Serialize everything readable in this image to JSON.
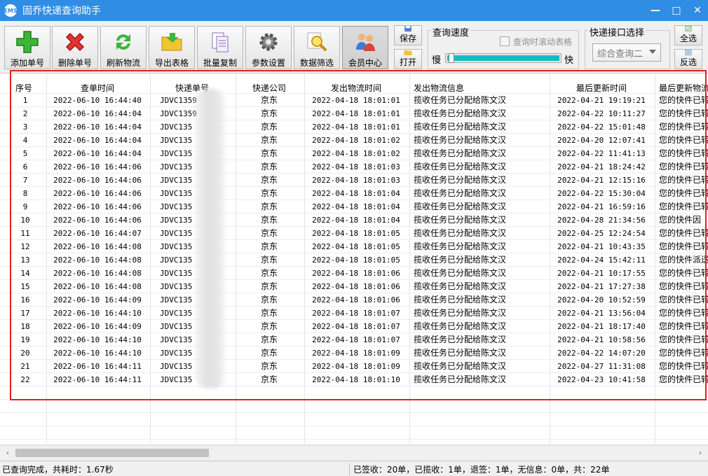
{
  "window": {
    "title": "固乔快递查询助手",
    "icon_text": "EMS",
    "minimize": "—",
    "maximize": "□",
    "close": "✕"
  },
  "toolbar": {
    "buttons": [
      {
        "label": "添加单号",
        "icon": "plus-icon"
      },
      {
        "label": "删除单号",
        "icon": "delete-x-icon"
      },
      {
        "label": "刷新物流",
        "icon": "refresh-icon"
      },
      {
        "label": "导出表格",
        "icon": "folder-export-icon"
      },
      {
        "label": "批量复制",
        "icon": "copy-pages-icon"
      },
      {
        "label": "参数设置",
        "icon": "gear-icon"
      },
      {
        "label": "数据筛选",
        "icon": "magnifier-icon"
      },
      {
        "label": "会员中心",
        "icon": "users-icon"
      }
    ],
    "save_label": "保存",
    "open_label": "打开",
    "speed": {
      "title": "查询速度",
      "scroll_checkbox_label": "查询时滚动表格",
      "slow_label": "慢",
      "fast_label": "快",
      "level": 1.0
    },
    "interface": {
      "title": "快递接口选择",
      "selected": "综合查询二"
    },
    "select_all_label": "全选",
    "invert_label": "反选"
  },
  "table": {
    "columns": [
      "序号",
      "查单时间",
      "快递单号",
      "快递公司",
      "发出物流时间",
      "发出物流信息",
      "最后更新时间",
      "最后更新物流"
    ],
    "rows": [
      [
        "1",
        "2022-06-10 16:44:40",
        "JDVC1359",
        "京东",
        "2022-04-18 18:01:01",
        "揽收任务已分配给陈文汉",
        "2022-04-21 19:19:21",
        "您的快件已转"
      ],
      [
        "2",
        "2022-06-10 16:44:04",
        "JDVC1359",
        "京东",
        "2022-04-18 18:01:01",
        "揽收任务已分配给陈文汉",
        "2022-04-22 10:11:27",
        "您的快件已转"
      ],
      [
        "3",
        "2022-06-10 16:44:04",
        "JDVC135",
        "京东",
        "2022-04-18 18:01:01",
        "揽收任务已分配给陈文汉",
        "2022-04-22 15:01:48",
        "您的快件已转"
      ],
      [
        "4",
        "2022-06-10 16:44:04",
        "JDVC135",
        "京东",
        "2022-04-18 18:01:02",
        "揽收任务已分配给陈文汉",
        "2022-04-20 12:07:41",
        "您的快件已转"
      ],
      [
        "5",
        "2022-06-10 16:44:04",
        "JDVC135",
        "京东",
        "2022-04-18 18:01:02",
        "揽收任务已分配给陈文汉",
        "2022-04-22 11:41:13",
        "您的快件已转"
      ],
      [
        "6",
        "2022-06-10 16:44:06",
        "JDVC135",
        "京东",
        "2022-04-18 18:01:03",
        "揽收任务已分配给陈文汉",
        "2022-04-21 18:24:42",
        "您的快件已转"
      ],
      [
        "7",
        "2022-06-10 16:44:06",
        "JDVC135",
        "京东",
        "2022-04-18 18:01:03",
        "揽收任务已分配给陈文汉",
        "2022-04-21 12:15:16",
        "您的快件已转"
      ],
      [
        "8",
        "2022-06-10 16:44:06",
        "JDVC135",
        "京东",
        "2022-04-18 18:01:04",
        "揽收任务已分配给陈文汉",
        "2022-04-22 15:30:04",
        "您的快件已转"
      ],
      [
        "9",
        "2022-06-10 16:44:06",
        "JDVC135",
        "京东",
        "2022-04-18 18:01:04",
        "揽收任务已分配给陈文汉",
        "2022-04-21 16:59:16",
        "您的快件已转"
      ],
      [
        "10",
        "2022-06-10 16:44:06",
        "JDVC135",
        "京东",
        "2022-04-18 18:01:04",
        "揽收任务已分配给陈文汉",
        "2022-04-28 21:34:56",
        "您的快件因"
      ],
      [
        "11",
        "2022-06-10 16:44:07",
        "JDVC135",
        "京东",
        "2022-04-18 18:01:05",
        "揽收任务已分配给陈文汉",
        "2022-04-25 12:24:54",
        "您的快件已转"
      ],
      [
        "12",
        "2022-06-10 16:44:08",
        "JDVC135",
        "京东",
        "2022-04-18 18:01:05",
        "揽收任务已分配给陈文汉",
        "2022-04-21 10:43:35",
        "您的快件已转"
      ],
      [
        "13",
        "2022-06-10 16:44:08",
        "JDVC135",
        "京东",
        "2022-04-18 18:01:05",
        "揽收任务已分配给陈文汉",
        "2022-04-24 15:42:11",
        "您的快件派送"
      ],
      [
        "14",
        "2022-06-10 16:44:08",
        "JDVC135",
        "京东",
        "2022-04-18 18:01:06",
        "揽收任务已分配给陈文汉",
        "2022-04-21 10:17:55",
        "您的快件已转"
      ],
      [
        "15",
        "2022-06-10 16:44:08",
        "JDVC135",
        "京东",
        "2022-04-18 18:01:06",
        "揽收任务已分配给陈文汉",
        "2022-04-21 17:27:38",
        "您的快件已转"
      ],
      [
        "16",
        "2022-06-10 16:44:09",
        "JDVC135",
        "京东",
        "2022-04-18 18:01:06",
        "揽收任务已分配给陈文汉",
        "2022-04-20 10:52:59",
        "您的快件已转"
      ],
      [
        "17",
        "2022-06-10 16:44:10",
        "JDVC135",
        "京东",
        "2022-04-18 18:01:07",
        "揽收任务已分配给陈文汉",
        "2022-04-21 13:56:04",
        "您的快件已转"
      ],
      [
        "18",
        "2022-06-10 16:44:09",
        "JDVC135",
        "京东",
        "2022-04-18 18:01:07",
        "揽收任务已分配给陈文汉",
        "2022-04-21 18:17:40",
        "您的快件已转"
      ],
      [
        "19",
        "2022-06-10 16:44:10",
        "JDVC135",
        "京东",
        "2022-04-18 18:01:07",
        "揽收任务已分配给陈文汉",
        "2022-04-21 10:58:56",
        "您的快件已转"
      ],
      [
        "20",
        "2022-06-10 16:44:10",
        "JDVC135",
        "京东",
        "2022-04-18 18:01:09",
        "揽收任务已分配给陈文汉",
        "2022-04-22 14:07:20",
        "您的快件已转"
      ],
      [
        "21",
        "2022-06-10 16:44:11",
        "JDVC135",
        "京东",
        "2022-04-18 18:01:09",
        "揽收任务已分配给陈文汉",
        "2022-04-27 11:31:08",
        "您的快件已转"
      ],
      [
        "22",
        "2022-06-10 16:44:11",
        "JDVC135",
        "京东",
        "2022-04-18 18:01:10",
        "揽收任务已分配给陈文汉",
        "2022-04-23 10:41:58",
        "您的快件已转"
      ]
    ]
  },
  "scrollbar": {
    "left_arrow": "‹",
    "right_arrow": "›"
  },
  "status": {
    "left": "已查询完成，共耗时：1.67秒",
    "right": "已签收：20单，已揽收：1单，退签：1单，无信息：0单，共：22单"
  },
  "colors": {
    "titlebar": "#2f8de4",
    "highlight_frame": "#e02020",
    "slider_fill": "#13bcc4"
  }
}
